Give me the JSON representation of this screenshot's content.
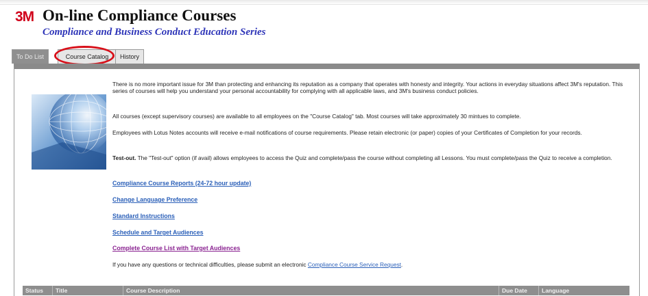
{
  "header": {
    "logo": "3M",
    "title": "On-line Compliance Courses",
    "subtitle": "Compliance and Business Conduct Education Series"
  },
  "tabs": [
    {
      "label": "To Do List",
      "state": "active"
    },
    {
      "label": "Course Catalog",
      "state": "highlighted"
    },
    {
      "label": "History",
      "state": "normal"
    }
  ],
  "intro": {
    "p1": "There is no more important issue for 3M than protecting and enhancing its reputation as a company that operates with honesty and integrity. Your actions in everyday situations affect 3M's reputation. This series of courses will help you understand your personal accountability for complying with all applicable laws, and 3M's business conduct policies.",
    "p2": "All courses (except supervisory courses) are available to all employees on the \"Course Catalog\" tab. Most courses will take approximately 30 mintues to complete.",
    "p3": "Employees with Lotus Notes accounts will receive e-mail notifications of course requirements. Please retain electronic (or paper) copies of your Certificates of Completion for your records.",
    "p4_bold": "Test-out.",
    "p4": " The \"Test-out\" option (if avail) allows employees to access the Quiz and complete/pass the course without completing all Lessons. You must complete/pass the Quiz to receive a completion."
  },
  "links": {
    "reports": "Compliance Course Reports (24-72 hour update)",
    "language": "Change Language Preference",
    "instructions": "Standard Instructions",
    "schedule": "Schedule and Target Audiences",
    "complete_list": "Complete Course List with Target Audiences"
  },
  "footer_note": {
    "text": "If you have any questions or technical difficulties, please submit an electronic ",
    "link": "Compliance Course Service Request",
    "end": "."
  },
  "table": {
    "columns": [
      "Status",
      "Title",
      "Course Description",
      "Due Date",
      "Language"
    ]
  },
  "colors": {
    "brand_red": "#d0021b",
    "subtitle_blue": "#2d34b8",
    "link_blue": "#2a5fb8",
    "visited_link": "#8a2391",
    "header_gray": "#8e8e8e"
  }
}
